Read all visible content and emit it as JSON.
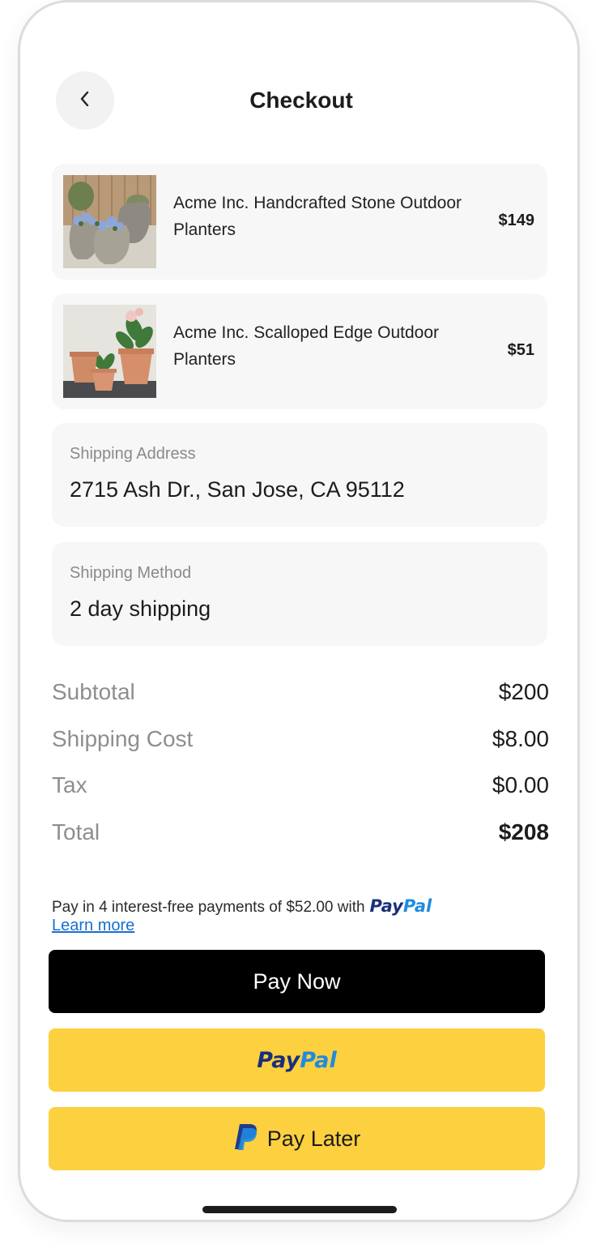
{
  "header": {
    "title": "Checkout"
  },
  "items": [
    {
      "name": "Acme Inc. Handcrafted Stone Outdoor Planters",
      "price": "$149"
    },
    {
      "name": "Acme Inc. Scalloped Edge Outdoor Planters",
      "price": "$51"
    }
  ],
  "shipping_address": {
    "label": "Shipping Address",
    "value": "2715 Ash Dr., San Jose, CA 95112"
  },
  "shipping_method": {
    "label": "Shipping Method",
    "value": "2 day shipping"
  },
  "summary": {
    "subtotal": {
      "label": "Subtotal",
      "value": "$200"
    },
    "shipping": {
      "label": "Shipping Cost",
      "value": "$8.00"
    },
    "tax": {
      "label": "Tax",
      "value": "$0.00"
    },
    "total": {
      "label": "Total",
      "value": "$208"
    }
  },
  "paylater_message": {
    "text": "Pay in 4 interest-free payments of $52.00 with",
    "brand_part1": "Pay",
    "brand_part2": "Pal",
    "learn_more": "Learn more"
  },
  "buttons": {
    "pay_now": "Pay Now",
    "paypal_part1": "Pay",
    "paypal_part2": "Pal",
    "pay_later": "Pay Later"
  },
  "colors": {
    "primary_button": "#000000",
    "paypal_yellow": "#fdd03f",
    "paypal_dark_blue": "#1a2f7a",
    "paypal_light_blue": "#1f8be0",
    "link_blue": "#1a6fd1"
  },
  "icons": {
    "back": "chevron-left-icon",
    "paypal_mark": "paypal-p-icon"
  }
}
